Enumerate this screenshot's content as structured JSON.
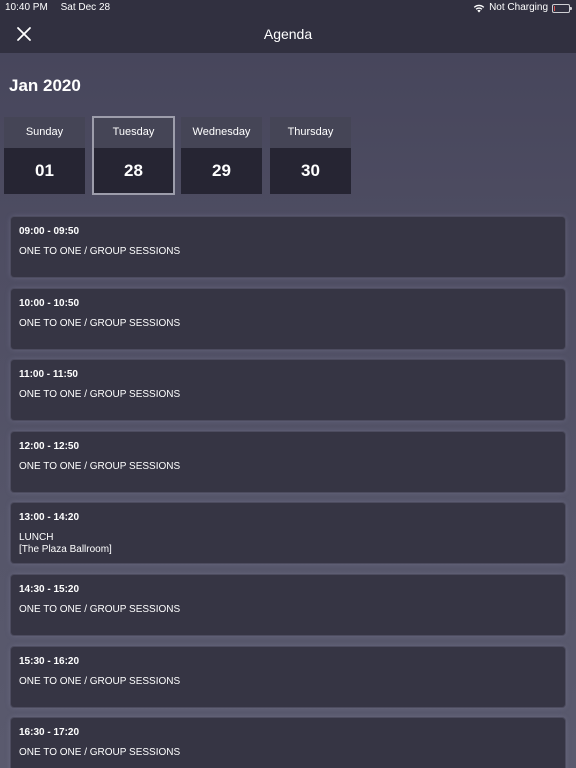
{
  "status_bar": {
    "time": "10:40 PM",
    "date": "Sat Dec 28",
    "charging": "Not Charging",
    "battery_level": 0.1
  },
  "nav": {
    "title": "Agenda",
    "close_icon": "close-icon"
  },
  "month_label": "Jan 2020",
  "days": [
    {
      "name": "Sunday",
      "number": "01",
      "selected": false
    },
    {
      "name": "Tuesday",
      "number": "28",
      "selected": true
    },
    {
      "name": "Wednesday",
      "number": "29",
      "selected": false
    },
    {
      "name": "Thursday",
      "number": "30",
      "selected": false
    }
  ],
  "events": [
    {
      "time": "09:00 - 09:50",
      "title": "ONE TO ONE / GROUP SESSIONS",
      "location": ""
    },
    {
      "time": "10:00 - 10:50",
      "title": "ONE TO ONE / GROUP SESSIONS",
      "location": ""
    },
    {
      "time": "11:00 - 11:50",
      "title": "ONE TO ONE / GROUP SESSIONS",
      "location": ""
    },
    {
      "time": "12:00 - 12:50",
      "title": "ONE TO ONE / GROUP SESSIONS",
      "location": ""
    },
    {
      "time": "13:00 - 14:20",
      "title": "LUNCH",
      "location": "[The Plaza Ballroom]"
    },
    {
      "time": "14:30 - 15:20",
      "title": "ONE TO ONE / GROUP SESSIONS",
      "location": ""
    },
    {
      "time": "15:30 - 16:20",
      "title": "ONE TO ONE / GROUP SESSIONS",
      "location": ""
    },
    {
      "time": "16:30 - 17:20",
      "title": "ONE TO ONE / GROUP SESSIONS",
      "location": ""
    }
  ],
  "colors": {
    "nav_bg": "#313040",
    "card_bg": "#363544",
    "day_name_bg": "#454556",
    "day_num_bg": "#262533",
    "text": "#ffffff"
  }
}
